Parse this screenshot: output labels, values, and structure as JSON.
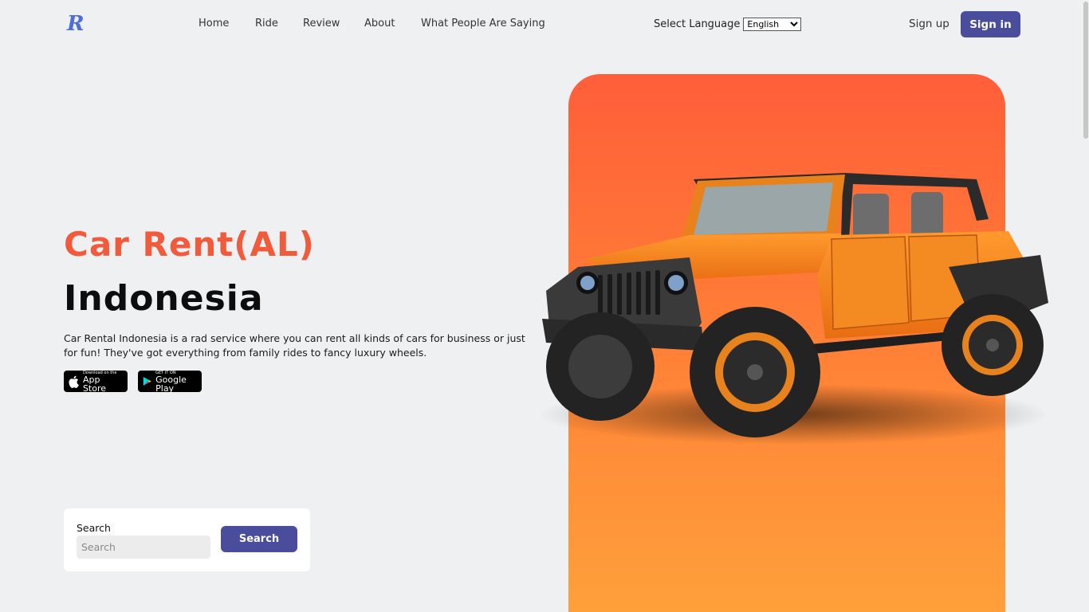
{
  "header": {
    "logo_letter": "R",
    "nav": [
      "Home",
      "Ride",
      "Review",
      "About",
      "What People Are Saying"
    ],
    "language_label": "Select Language",
    "language_selected": "English",
    "signup_label": "Sign up",
    "signin_label": "Sign in"
  },
  "hero": {
    "title": "Car Rent(AL)",
    "subtitle": "Indonesia",
    "description": "Car Rental Indonesia is a rad service where you can rent all kinds of cars for business or just for fun! They've got everything from family rides to fancy luxury wheels.",
    "app_store": {
      "small": "Download on the",
      "big": "App Store"
    },
    "google_play": {
      "small": "GET IT ON",
      "big": "Google Play"
    }
  },
  "search": {
    "label": "Search",
    "placeholder": "Search",
    "button_label": "Search"
  },
  "colors": {
    "accent": "#4a4c9c",
    "brand_orange": "#f15a3a",
    "panel_top": "#ff5e3a",
    "panel_bottom": "#ffa23a",
    "background": "#eff0f2"
  }
}
